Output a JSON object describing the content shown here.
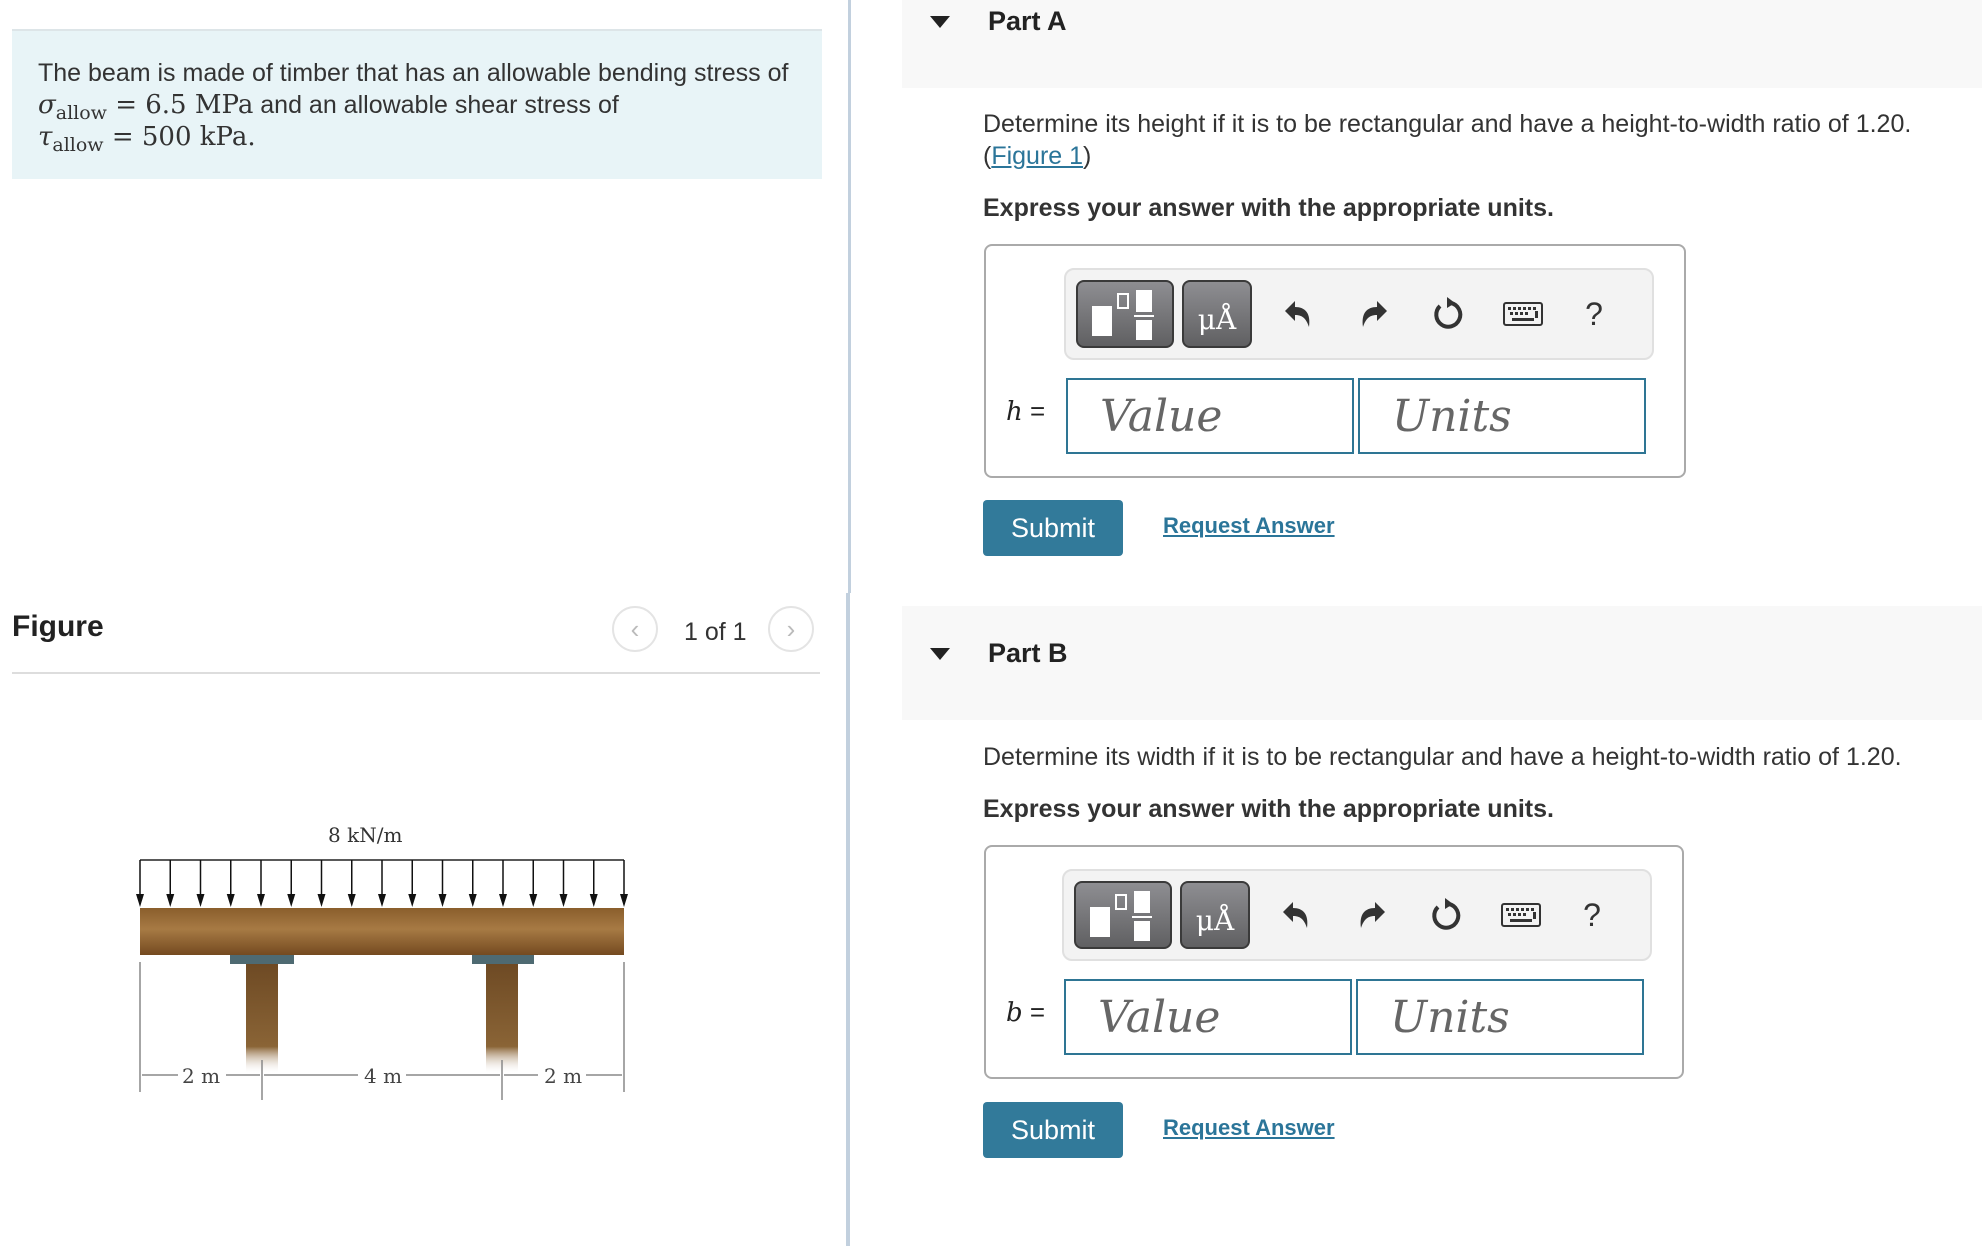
{
  "intro": {
    "text_start": "The beam is made of timber that has an allowable bending stress of ",
    "sigma_symbol": "σ",
    "sigma_sub": "allow",
    "sigma_value": " = 6.5 MPa",
    "text_mid": " and an allowable shear stress of ",
    "tau_symbol": "τ",
    "tau_sub": "allow",
    "tau_value": " = 500 kPa",
    "text_end": "."
  },
  "figure": {
    "title": "Figure",
    "page": "1 of 1",
    "prev_icon": "chevron-left-icon",
    "next_icon": "chevron-right-icon",
    "load_label": "8 kN/m",
    "dims": [
      "2 m",
      "4 m",
      "2 m"
    ]
  },
  "parts": [
    {
      "title": "Part A",
      "question": "Determine its height if it is to be rectangular and have a height-to-width ratio of 1.20.",
      "figure_link_open": "(",
      "figure_link": "Figure 1",
      "figure_link_close": ")",
      "instruction": "Express your answer with the appropriate units.",
      "variable": "h",
      "equals": " =",
      "value_placeholder": "Value",
      "units_placeholder": "Units",
      "units_button": "μÅ",
      "help": "?",
      "submit": "Submit",
      "request": "Request Answer"
    },
    {
      "title": "Part B",
      "question": "Determine its width if it is to be rectangular and have a height-to-width ratio of 1.20.",
      "instruction": "Express your answer with the appropriate units.",
      "variable": "b",
      "equals": " =",
      "value_placeholder": "Value",
      "units_placeholder": "Units",
      "units_button": "μÅ",
      "help": "?",
      "submit": "Submit",
      "request": "Request Answer"
    }
  ],
  "colors": {
    "accent": "#327a9a",
    "link": "#2b7599",
    "intro_bg": "#e8f4f7",
    "part_header_bg": "#f8f8f8",
    "divider": "#c2d0de"
  }
}
